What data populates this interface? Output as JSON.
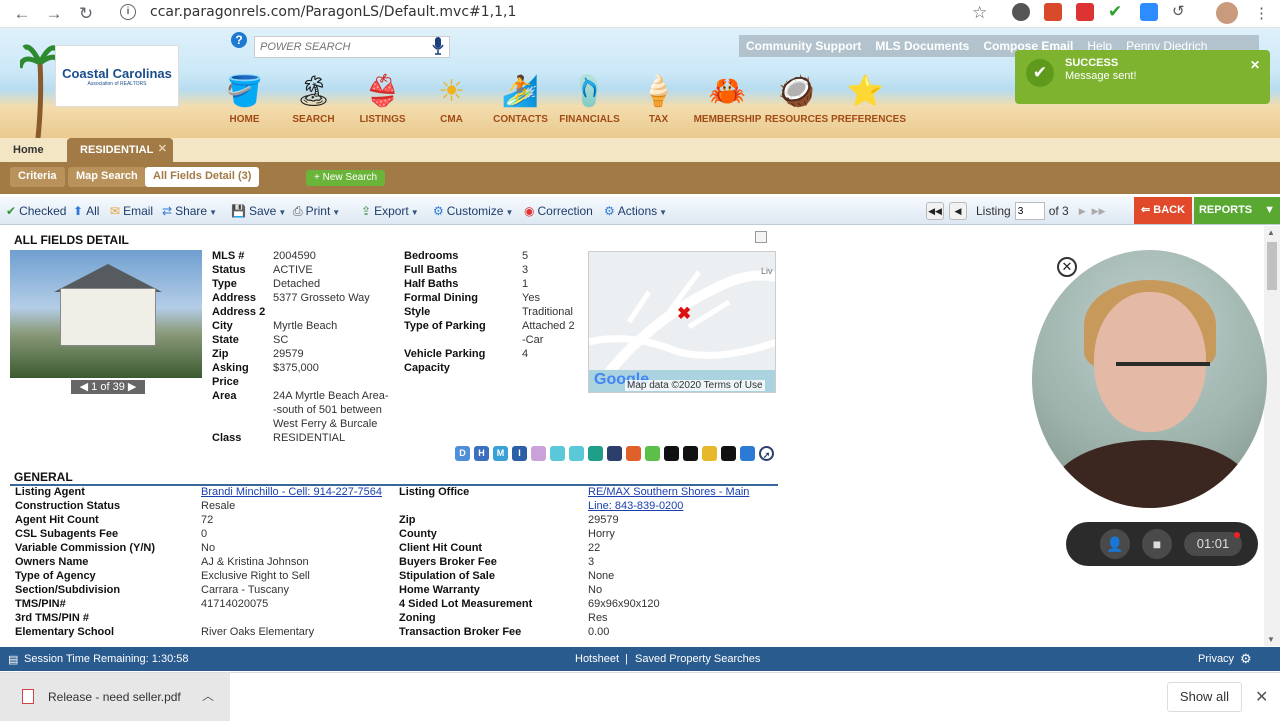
{
  "browser": {
    "url": "ccar.paragonrels.com/ParagonLS/Default.mvc#1,1,1"
  },
  "header": {
    "logo_line1": "Coastal Carolinas",
    "logo_line2": "Association of REALTORS",
    "power_search_placeholder": "POWER SEARCH",
    "top_links": [
      "Community Support",
      "MLS Documents",
      "Compose Email",
      "Help",
      "Penny Diedrich"
    ],
    "menu": [
      {
        "label": "HOME",
        "icon": "bucket-icon",
        "glyph": "🪣"
      },
      {
        "label": "SEARCH",
        "icon": "palm-tree-icon",
        "glyph": "🏝"
      },
      {
        "label": "LISTINGS",
        "icon": "bikini-icon",
        "glyph": "👙"
      },
      {
        "label": "CMA",
        "icon": "sun-icon",
        "glyph": "☀"
      },
      {
        "label": "CONTACTS",
        "icon": "surfboard-icon",
        "glyph": "🏄"
      },
      {
        "label": "FINANCIALS",
        "icon": "flip-flops-icon",
        "glyph": "🩴"
      },
      {
        "label": "TAX",
        "icon": "popsicle-icon",
        "glyph": "🍦"
      },
      {
        "label": "MEMBERSHIP",
        "icon": "crab-icon",
        "glyph": "🦀"
      },
      {
        "label": "RESOURCES",
        "icon": "coconut-icon",
        "glyph": "🥥"
      },
      {
        "label": "PREFERENCES",
        "icon": "starfish-icon",
        "glyph": "⭐"
      }
    ]
  },
  "tabs": {
    "home": "Home",
    "active": "RESIDENTIAL",
    "subtabs": [
      "Criteria",
      "Map Search",
      "All Fields Detail (3)"
    ],
    "new_search": "+ New Search"
  },
  "toolbar": {
    "items": [
      "Checked",
      "All",
      "Email",
      "Share",
      "Print",
      "Save",
      "Export",
      "Customize",
      "Correction",
      "Actions"
    ],
    "listing_label": "Listing",
    "listing_value": "3",
    "of_total": "of 3",
    "back": "BACK",
    "reports": "REPORTS"
  },
  "detail": {
    "section_title": "ALL FIELDS DETAIL",
    "photo_pager": "1 of 39",
    "left_fields": [
      {
        "k": "MLS #",
        "v": "2004590"
      },
      {
        "k": "Status",
        "v": "ACTIVE"
      },
      {
        "k": "Type",
        "v": "Detached"
      },
      {
        "k": "Address",
        "v": "5377 Grosseto Way"
      },
      {
        "k": "Address 2",
        "v": ""
      },
      {
        "k": "City",
        "v": "Myrtle Beach"
      },
      {
        "k": "State",
        "v": "SC"
      },
      {
        "k": "Zip",
        "v": "29579"
      },
      {
        "k": "Asking",
        "v": "$375,000"
      },
      {
        "k": "Price",
        "v": ""
      },
      {
        "k": "Area",
        "v": "24A Myrtle Beach Area-"
      },
      {
        "k": "",
        "v": "-south of 501 between"
      },
      {
        "k": "",
        "v": "West Ferry & Burcale"
      },
      {
        "k": "Class",
        "v": "RESIDENTIAL"
      }
    ],
    "right_fields": [
      {
        "k": "Bedrooms",
        "v": "5"
      },
      {
        "k": "Full Baths",
        "v": "3"
      },
      {
        "k": "Half Baths",
        "v": "1"
      },
      {
        "k": "Formal Dining",
        "v": "Yes"
      },
      {
        "k": "Style",
        "v": "Traditional"
      },
      {
        "k": "Type of Parking",
        "v": "Attached 2"
      },
      {
        "k": "",
        "v": "-Car"
      },
      {
        "k": "Vehicle Parking",
        "v": "4"
      },
      {
        "k": "Capacity",
        "v": ""
      }
    ],
    "map_label": "Liv",
    "map_footer": "Map data ©2020   Terms of Use",
    "map_logo": "Google",
    "badges": [
      "D",
      "H",
      "M",
      "I"
    ]
  },
  "general": {
    "title": "GENERAL",
    "left": [
      {
        "k": "Listing Agent",
        "v": "Brandi Minchillo - Cell: 914-227-7564",
        "link": true
      },
      {
        "k": "Construction Status",
        "v": "Resale"
      },
      {
        "k": "Agent Hit Count",
        "v": "72"
      },
      {
        "k": "CSL Subagents Fee",
        "v": "0"
      },
      {
        "k": "Variable Commission (Y/N)",
        "v": "No"
      },
      {
        "k": "Owners Name",
        "v": "AJ & Kristina Johnson"
      },
      {
        "k": "Type of Agency",
        "v": "Exclusive Right to Sell"
      },
      {
        "k": "Section/Subdivision",
        "v": "Carrara - Tuscany"
      },
      {
        "k": "TMS/PIN#",
        "v": "41714020075"
      },
      {
        "k": "3rd TMS/PIN #",
        "v": ""
      },
      {
        "k": "Elementary School",
        "v": "River Oaks Elementary"
      }
    ],
    "right": [
      {
        "k": "Listing Office",
        "v": "RE/MAX Southern Shores - Main",
        "link": true
      },
      {
        "k": "",
        "v": "Line: 843-839-0200",
        "link": true
      },
      {
        "k": "Zip",
        "v": "29579"
      },
      {
        "k": "County",
        "v": "Horry"
      },
      {
        "k": "Client Hit Count",
        "v": "22"
      },
      {
        "k": "Buyers Broker Fee",
        "v": "3"
      },
      {
        "k": "Stipulation of Sale",
        "v": "None"
      },
      {
        "k": "Home Warranty",
        "v": "No"
      },
      {
        "k": "4 Sided Lot Measurement",
        "v": "69x96x90x120"
      },
      {
        "k": "Zoning",
        "v": "Res"
      },
      {
        "k": "Transaction Broker Fee",
        "v": "0.00"
      }
    ]
  },
  "footer": {
    "session": "Session Time Remaining: 1:30:58",
    "hotsheet": "Hotsheet",
    "sep": "|",
    "saved": "Saved Property Searches",
    "privacy": "Privacy"
  },
  "downloads": {
    "file": "Release - need seller.pdf",
    "show_all": "Show all"
  },
  "toast": {
    "title": "SUCCESS",
    "message": "Message sent!"
  },
  "recorder": {
    "time": "01:01"
  }
}
